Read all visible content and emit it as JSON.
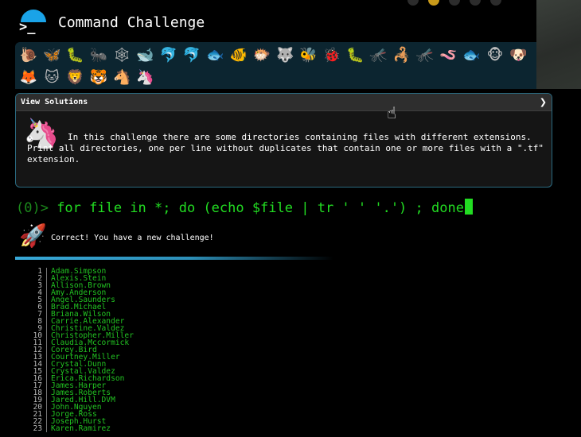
{
  "header": {
    "title": "Command Challenge",
    "logo_glyph": ">_"
  },
  "progress_strip": {
    "row1": [
      "🐌",
      "🦋",
      "🐛",
      "🐜",
      "🕸",
      "🐋",
      "🐬",
      "🐬",
      "🐟",
      "🐠",
      "🐡",
      "🐺",
      "🐝",
      "🐞",
      "🐛",
      "🦟",
      "🦂",
      "🦟",
      "🪱",
      "🐟",
      "🐵",
      "🐶"
    ],
    "row2": [
      "🦊",
      "🐱",
      "🦁",
      "🐯",
      "🐴",
      "🦄"
    ]
  },
  "solutions_panel": {
    "title": "View Solutions",
    "toggle": "❯",
    "avatar": "🦄",
    "description": "In this challenge there are some directories containing files with different extensions. Print all directories, one per line without duplicates that contain one or more files with a \".tf\" extension."
  },
  "prompt": {
    "counter": "(0)>",
    "command": " for file in *; do (echo $file | tr ' ' '.') ; done"
  },
  "result": {
    "icon": "🚀",
    "message": "Correct! You have a new challenge!"
  },
  "output": [
    {
      "n": "1",
      "t": "Adam.Simpson"
    },
    {
      "n": "2",
      "t": "Alexis.Stein"
    },
    {
      "n": "3",
      "t": "Allison.Brown"
    },
    {
      "n": "4",
      "t": "Amy.Anderson"
    },
    {
      "n": "5",
      "t": "Angel.Saunders"
    },
    {
      "n": "6",
      "t": "Brad.Michael"
    },
    {
      "n": "7",
      "t": "Briana.Wilson"
    },
    {
      "n": "8",
      "t": "Carrie.Alexander"
    },
    {
      "n": "9",
      "t": "Christine.Valdez"
    },
    {
      "n": "10",
      "t": "Christopher.Miller"
    },
    {
      "n": "11",
      "t": "Claudia.Mccormick"
    },
    {
      "n": "12",
      "t": "Corey.Bird"
    },
    {
      "n": "13",
      "t": "Courtney.Miller"
    },
    {
      "n": "14",
      "t": "Crystal.Dunn"
    },
    {
      "n": "15",
      "t": "Crystal.Valdez"
    },
    {
      "n": "16",
      "t": "Erica.Richardson"
    },
    {
      "n": "17",
      "t": "James.Harper"
    },
    {
      "n": "18",
      "t": "James.Roberts"
    },
    {
      "n": "19",
      "t": "Jared.Hill.DVM"
    },
    {
      "n": "20",
      "t": "John.Nguyen"
    },
    {
      "n": "21",
      "t": "Jorge.Ross"
    },
    {
      "n": "22",
      "t": "Joseph.Hurst"
    },
    {
      "n": "23",
      "t": "Karen.Ramirez"
    }
  ],
  "colors": {
    "accent": "#1aa3e8",
    "prompt_green": "#22dd22",
    "output_green": "#22c322",
    "panel_border": "#2a6a80"
  }
}
